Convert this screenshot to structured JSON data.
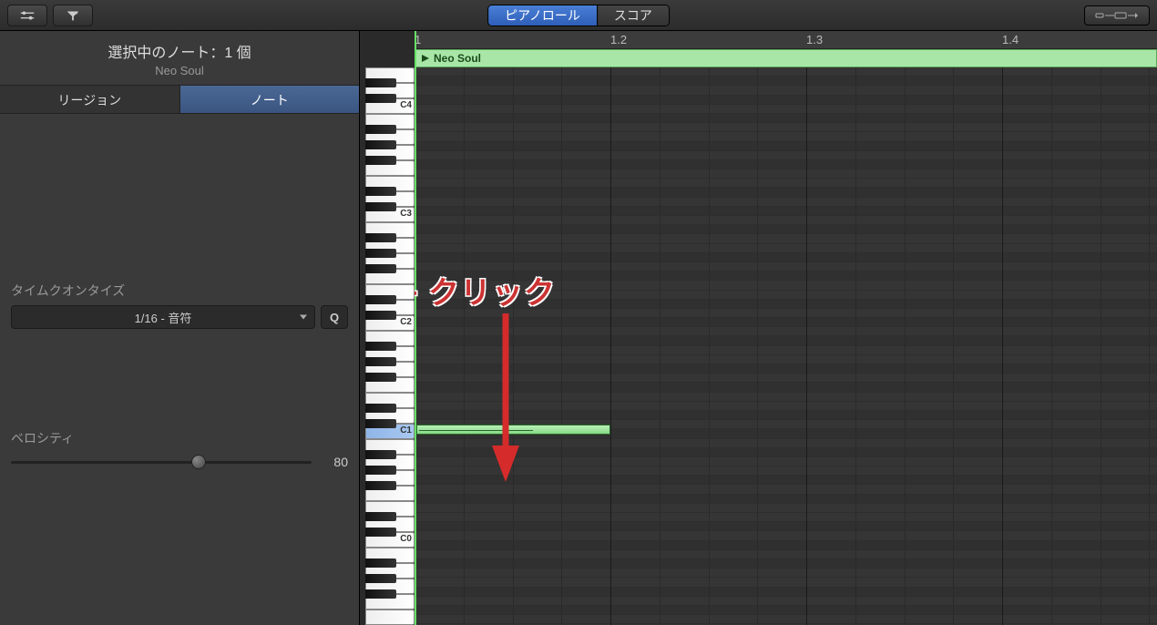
{
  "header": {
    "tabs": {
      "piano_roll": "ピアノロール",
      "score": "スコア"
    }
  },
  "sidebar": {
    "title": "選択中のノート：1 個",
    "subtitle": "Neo Soul",
    "tabs": {
      "region": "リージョン",
      "note": "ノート"
    },
    "quantize_label": "タイムクオンタイズ",
    "quantize_value": "1/16 - 音符",
    "q_button": "Q",
    "velocity_label": "ベロシティ",
    "velocity_value": "80"
  },
  "region": {
    "name": "Neo Soul"
  },
  "ruler": {
    "beats": [
      "1",
      "1.2",
      "1.3",
      "1.4"
    ]
  },
  "keyboard": {
    "labels": [
      "C4",
      "C3",
      "C2",
      "C1",
      "C0"
    ]
  },
  "annotation": {
    "text": "Command + クリック"
  },
  "note": {
    "start_beat": 1.0,
    "end_beat": 1.2,
    "pitch": "C1"
  }
}
